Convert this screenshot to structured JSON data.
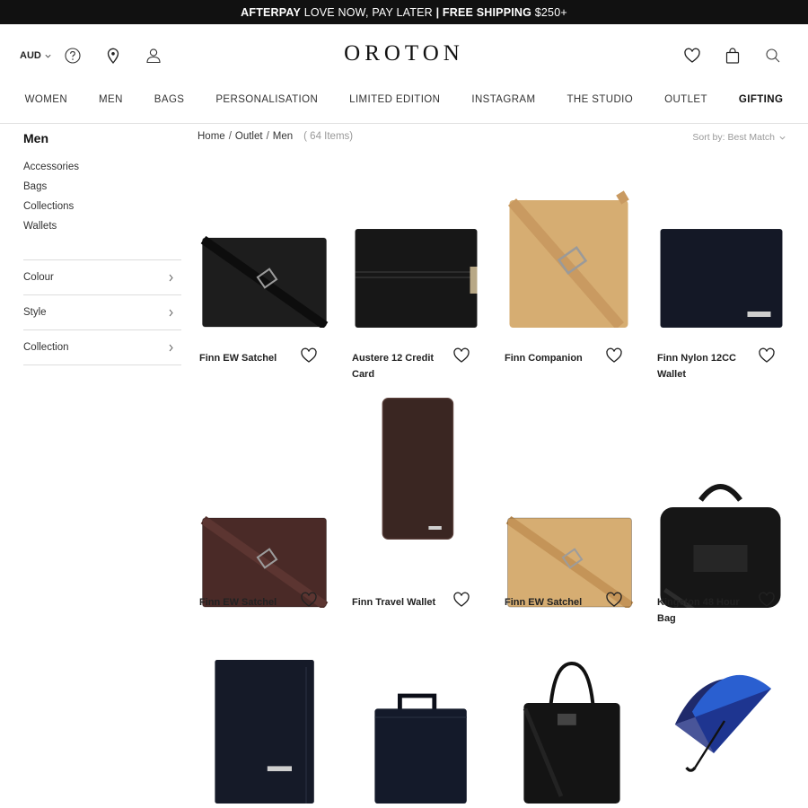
{
  "promo": {
    "part1": "AFTERPAY",
    "part2": " LOVE NOW, PAY LATER ",
    "part3": "| FREE SHIPPING",
    "part4": " $250+"
  },
  "header": {
    "currency": "AUD",
    "logo": "OROTON"
  },
  "nav": [
    "WOMEN",
    "MEN",
    "BAGS",
    "PERSONALISATION",
    "LIMITED EDITION",
    "INSTAGRAM",
    "THE STUDIO",
    "OUTLET",
    "GIFTING"
  ],
  "sidebar": {
    "title": "Men",
    "links": [
      "Accessories",
      "Bags",
      "Collections",
      "Wallets"
    ],
    "filters": [
      "Colour",
      "Style",
      "Collection"
    ]
  },
  "breadcrumb": {
    "home": "Home",
    "outlet": "Outlet",
    "men": "Men",
    "count": "( 64 Items)"
  },
  "sort": {
    "label": "Sort by: Best Match"
  },
  "products": [
    {
      "name": "Finn EW Satchel",
      "color": "#1d1d1d",
      "kind": "satchel"
    },
    {
      "name": "Austere 12 Credit Card",
      "color": "#171717",
      "kind": "wallet"
    },
    {
      "name": "Finn Companion",
      "color": "#d6ad72",
      "kind": "companion"
    },
    {
      "name": "Finn Nylon 12CC Wallet",
      "color": "#141826",
      "kind": "wallet"
    },
    {
      "name": "Finn EW Satchel",
      "color": "#4a2a27",
      "kind": "satchel"
    },
    {
      "name": "Finn Travel Wallet",
      "color": "#3a2622",
      "kind": "travel"
    },
    {
      "name": "Finn EW Satchel",
      "color": "#d6ad72",
      "kind": "satchel"
    },
    {
      "name": "Kingston 48 Hour Bag",
      "color": "#161616",
      "kind": "duffel"
    },
    {
      "name": "",
      "color": "#151a28",
      "kind": "tall-wallet"
    },
    {
      "name": "",
      "color": "#141a2a",
      "kind": "briefcase"
    },
    {
      "name": "",
      "color": "#141414",
      "kind": "tote"
    },
    {
      "name": "",
      "color": "#2a5fd0",
      "kind": "umbrella"
    }
  ]
}
